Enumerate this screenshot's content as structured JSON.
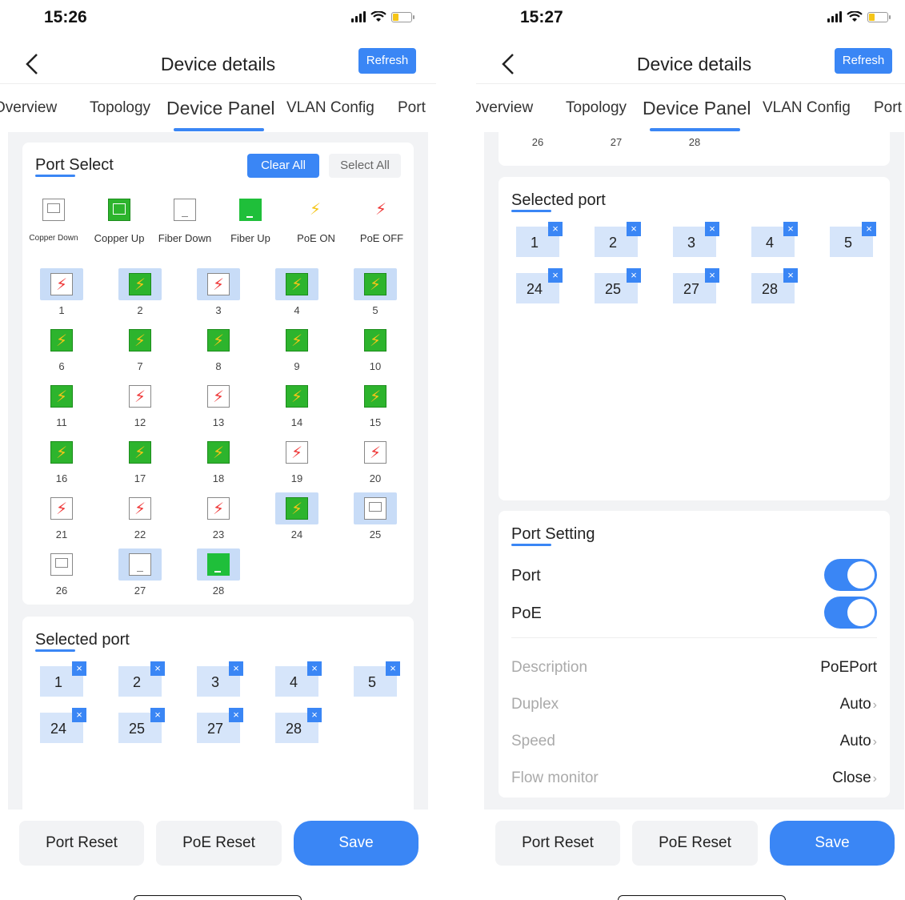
{
  "left": {
    "time": "15:26",
    "nav": {
      "title": "Device details",
      "refresh": "Refresh"
    },
    "tabs": [
      "Overview",
      "Topology",
      "Device Panel",
      "VLAN Config",
      "Port"
    ],
    "port_select": {
      "title": "Port Select",
      "clear_all": "Clear All",
      "select_all": "Select All",
      "legend": [
        "Copper Down",
        "Copper Up",
        "Fiber Down",
        "Fiber Up",
        "PoE ON",
        "PoE OFF"
      ],
      "ports": [
        {
          "n": "1",
          "type": "poe-off",
          "sel": true
        },
        {
          "n": "2",
          "type": "poe-on",
          "sel": true
        },
        {
          "n": "3",
          "type": "poe-off",
          "sel": true
        },
        {
          "n": "4",
          "type": "poe-on",
          "sel": true
        },
        {
          "n": "5",
          "type": "poe-on",
          "sel": true
        },
        {
          "n": "6",
          "type": "poe-on",
          "sel": false
        },
        {
          "n": "7",
          "type": "poe-on",
          "sel": false
        },
        {
          "n": "8",
          "type": "poe-on",
          "sel": false
        },
        {
          "n": "9",
          "type": "poe-on",
          "sel": false
        },
        {
          "n": "10",
          "type": "poe-on",
          "sel": false
        },
        {
          "n": "11",
          "type": "poe-on",
          "sel": false
        },
        {
          "n": "12",
          "type": "poe-off",
          "sel": false
        },
        {
          "n": "13",
          "type": "poe-off",
          "sel": false
        },
        {
          "n": "14",
          "type": "poe-on",
          "sel": false
        },
        {
          "n": "15",
          "type": "poe-on",
          "sel": false
        },
        {
          "n": "16",
          "type": "poe-on",
          "sel": false
        },
        {
          "n": "17",
          "type": "poe-on",
          "sel": false
        },
        {
          "n": "18",
          "type": "poe-on",
          "sel": false
        },
        {
          "n": "19",
          "type": "poe-off",
          "sel": false
        },
        {
          "n": "20",
          "type": "poe-off",
          "sel": false
        },
        {
          "n": "21",
          "type": "poe-off",
          "sel": false
        },
        {
          "n": "22",
          "type": "poe-off",
          "sel": false
        },
        {
          "n": "23",
          "type": "poe-off",
          "sel": false
        },
        {
          "n": "24",
          "type": "poe-on",
          "sel": true
        },
        {
          "n": "25",
          "type": "copper-down",
          "sel": true
        },
        {
          "n": "26",
          "type": "copper-down",
          "sel": false
        },
        {
          "n": "27",
          "type": "fiber-down",
          "sel": true
        },
        {
          "n": "28",
          "type": "fiber-up",
          "sel": true
        }
      ]
    },
    "selected": {
      "title": "Selected port",
      "ports": [
        "1",
        "2",
        "3",
        "4",
        "5",
        "24",
        "25",
        "27",
        "28"
      ]
    },
    "bottom": {
      "port_reset": "Port Reset",
      "poe_reset": "PoE Reset",
      "save": "Save"
    }
  },
  "right": {
    "time": "15:27",
    "nav": {
      "title": "Device details",
      "refresh": "Refresh"
    },
    "tabs": [
      "Overview",
      "Topology",
      "Device Panel",
      "VLAN Config",
      "Port"
    ],
    "partial_ports": [
      "26",
      "27",
      "28"
    ],
    "selected": {
      "title": "Selected port",
      "ports": [
        "1",
        "2",
        "3",
        "4",
        "5",
        "24",
        "25",
        "27",
        "28"
      ]
    },
    "port_setting": {
      "title": "Port Setting",
      "port_label": "Port",
      "poe_label": "PoE",
      "description_label": "Description",
      "description_value": "PoEPort",
      "duplex_label": "Duplex",
      "duplex_value": "Auto",
      "speed_label": "Speed",
      "speed_value": "Auto",
      "flow_label": "Flow monitor",
      "flow_value": "Close"
    },
    "bottom": {
      "port_reset": "Port Reset",
      "poe_reset": "PoE Reset",
      "save": "Save"
    }
  },
  "colors": {
    "accent": "#3a86f5",
    "poe_on": "#f5c518",
    "poe_off": "#ef3a3a",
    "link_up": "#2db42d"
  }
}
